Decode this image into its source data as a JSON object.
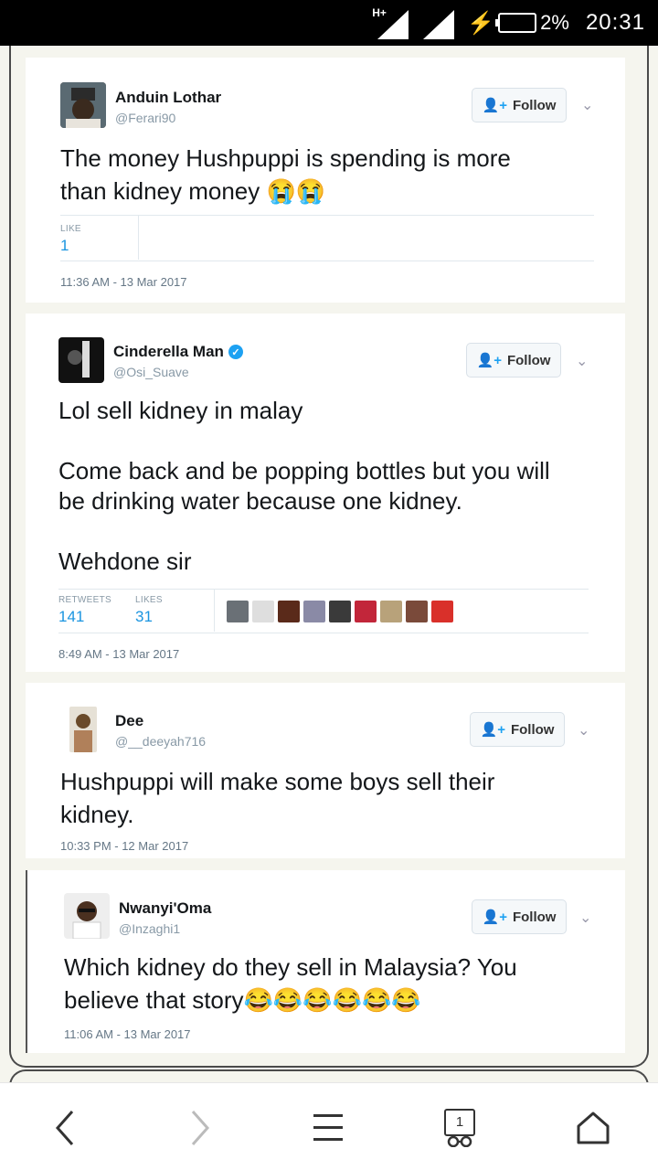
{
  "status": {
    "network": "H+",
    "battery_pct": "2%",
    "time": "20:31"
  },
  "tweets": [
    {
      "name": "Anduin Lothar",
      "handle": "@Ferari90",
      "follow_label": "Follow",
      "text_lines": [
        "The money Hushpuppi is spending is more",
        "than kidney money 😭😭"
      ],
      "likes_label": "LIKE",
      "likes": "1",
      "timestamp": "11:36 AM - 13 Mar 2017"
    },
    {
      "name": "Cinderella Man",
      "verified": true,
      "handle": "@Osi_Suave",
      "follow_label": "Follow",
      "text_lines": [
        "Lol sell kidney in malay",
        "",
        "Come back and be popping bottles but you will",
        "be drinking water because one kidney.",
        "",
        "Wehdone sir"
      ],
      "retweets_label": "RETWEETS",
      "retweets": "141",
      "likes_label": "LIKES",
      "likes": "31",
      "timestamp": "8:49 AM - 13 Mar 2017"
    },
    {
      "name": "Dee",
      "handle": "@__deeyah716",
      "follow_label": "Follow",
      "text_lines": [
        "Hushpuppi will make some boys sell their",
        "kidney."
      ],
      "timestamp": "10:33 PM - 12 Mar 2017"
    },
    {
      "name": "Nwanyi'Oma",
      "handle": "@Inzaghi1",
      "follow_label": "Follow",
      "text_lines": [
        "Which kidney do they sell in Malaysia? You",
        "believe that story😂😂😂😂😂😂"
      ],
      "timestamp": "11:06 AM - 13 Mar 2017"
    }
  ],
  "navbar": {
    "tab_count": "1"
  },
  "colors": {
    "link_blue": "#1b95e0",
    "twitter_blue": "#1da1f2",
    "text": "#14171a",
    "muted": "#8899a6"
  }
}
